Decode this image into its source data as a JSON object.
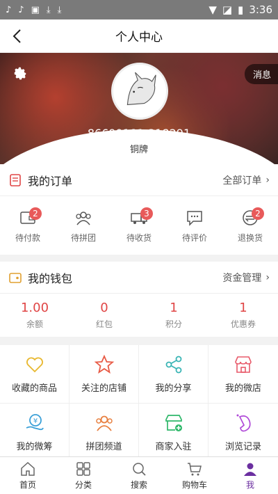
{
  "status_bar": {
    "time": "3:36"
  },
  "header": {
    "title": "个人中心"
  },
  "profile": {
    "message_label": "消息",
    "user_id": "86699181-318291",
    "level": "铜牌"
  },
  "orders": {
    "title": "我的订单",
    "all_label": "全部订单",
    "items": [
      {
        "label": "待付款",
        "badge": "2"
      },
      {
        "label": "待拼团",
        "badge": ""
      },
      {
        "label": "待收货",
        "badge": "3"
      },
      {
        "label": "待评价",
        "badge": ""
      },
      {
        "label": "退换货",
        "badge": "2"
      }
    ]
  },
  "wallet": {
    "title": "我的钱包",
    "manage_label": "资金管理",
    "items": [
      {
        "value": "1.00",
        "label": "余额"
      },
      {
        "value": "0",
        "label": "红包"
      },
      {
        "value": "1",
        "label": "积分"
      },
      {
        "value": "1",
        "label": "优惠券"
      }
    ]
  },
  "features": [
    {
      "label": "收藏的商品",
      "icon": "heart-icon"
    },
    {
      "label": "关注的店铺",
      "icon": "star-icon"
    },
    {
      "label": "我的分享",
      "icon": "share-icon"
    },
    {
      "label": "我的微店",
      "icon": "shop-icon"
    },
    {
      "label": "我的微筹",
      "icon": "crowdfund-icon"
    },
    {
      "label": "拼团频道",
      "icon": "group-icon"
    },
    {
      "label": "商家入驻",
      "icon": "store-add-icon"
    },
    {
      "label": "浏览记录",
      "icon": "footprint-icon"
    }
  ],
  "tabbar": {
    "items": [
      {
        "label": "首页"
      },
      {
        "label": "分类"
      },
      {
        "label": "搜索"
      },
      {
        "label": "购物车"
      },
      {
        "label": "我"
      }
    ]
  },
  "colors": {
    "accent": "#e04545",
    "active_tab": "#6b2fa0"
  }
}
